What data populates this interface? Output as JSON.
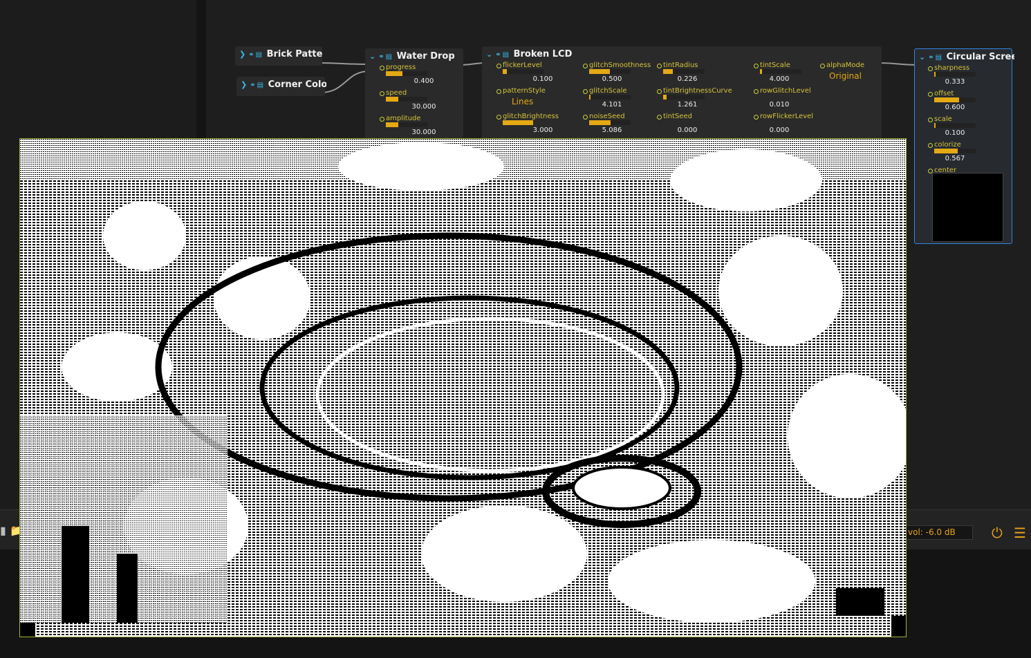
{
  "nodes": {
    "brick_pattern": {
      "title": "Brick Pattern"
    },
    "corner_colors": {
      "title": "Corner Colors"
    },
    "water_drop": {
      "title": "Water Drop",
      "params": [
        {
          "label": "progress",
          "value": "0.400",
          "fill": 0.4
        },
        {
          "label": "speed",
          "value": "30.000",
          "fill": 0.3
        },
        {
          "label": "amplitude",
          "value": "30.000",
          "fill": 0.3
        }
      ]
    },
    "broken_lcd": {
      "title": "Broken LCD",
      "col1": [
        {
          "label": "flickerLevel",
          "value": "0.100",
          "fill": 0.1
        },
        {
          "label": "patternStyle",
          "enum": "Lines"
        },
        {
          "label": "glitchBrightness",
          "value": "3.000",
          "fill": 1.0
        }
      ],
      "col2": [
        {
          "label": "glitchSmoothness",
          "value": "0.500",
          "fill": 0.5
        },
        {
          "label": "glitchScale",
          "value": "4.101",
          "fill": 0.0
        },
        {
          "label": "noiseSeed",
          "value": "5.086",
          "fill": 0.51
        }
      ],
      "col3": [
        {
          "label": "tintRadius",
          "value": "0.226",
          "fill": 0.23
        },
        {
          "label": "tintBrightnessCurve",
          "value": "1.261",
          "fill": 0.08
        },
        {
          "label": "tintSeed",
          "value": "0.000",
          "fill": 0.0
        }
      ],
      "col4": [
        {
          "label": "tintScale",
          "value": "4.000",
          "fill": 0.05
        },
        {
          "label": "rowGlitchLevel",
          "value": "0.010",
          "fill": 0.0
        },
        {
          "label": "rowFlickerLevel",
          "value": "0.000",
          "fill": 0.0
        }
      ],
      "col5": [
        {
          "label": "alphaMode",
          "enum": "Original"
        }
      ]
    },
    "circular_screen": {
      "title": "Circular Screen",
      "params": [
        {
          "label": "sharpness",
          "value": "0.333",
          "fill": 0.03
        },
        {
          "label": "offset",
          "value": "0.600",
          "fill": 0.6
        },
        {
          "label": "scale",
          "value": "0.100",
          "fill": 0.03
        },
        {
          "label": "colorize",
          "value": "0.567",
          "fill": 0.57
        },
        {
          "label": "center"
        }
      ]
    }
  },
  "bottombar": {
    "volume": "vol: -6.0 dB",
    "power_icon": "power-icon",
    "mixer_icon": "sliders-icon"
  },
  "colors": {
    "accent": "#e5a914",
    "param_label": "#d6c23a",
    "node_icon": "#39b6e8",
    "selection": "#2f86e0"
  }
}
